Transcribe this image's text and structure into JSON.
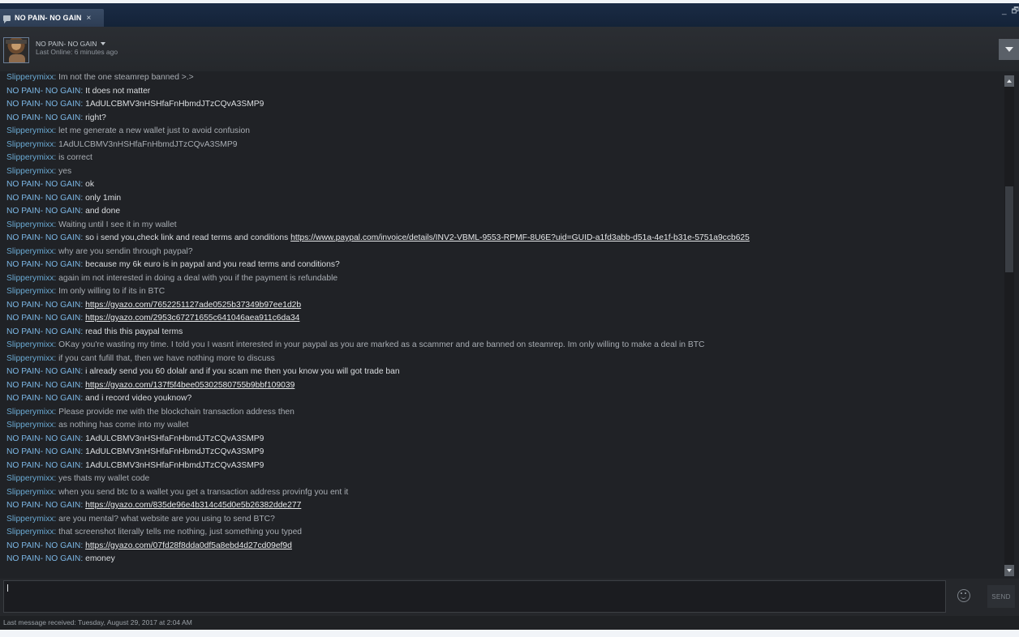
{
  "window": {
    "tab_title": "NO PAIN- NO GAIN",
    "tab_close": "×",
    "minimize": "_",
    "maximize": "🗗"
  },
  "header": {
    "friend_name": "NO PAIN- NO GAIN",
    "status": "Last Online: 6 minutes ago"
  },
  "messages": [
    {
      "sender": "Slipperymixx",
      "text": "Im not the one steamrep banned >.>",
      "link": false
    },
    {
      "sender": "NO PAIN- NO GAIN",
      "text": "It does not matter",
      "link": false
    },
    {
      "sender": "NO PAIN- NO GAIN",
      "text": "1AdULCBMV3nHSHfaFnHbmdJTzCQvA3SMP9",
      "link": false
    },
    {
      "sender": "NO PAIN- NO GAIN",
      "text": "right?",
      "link": false
    },
    {
      "sender": "Slipperymixx",
      "text": "let me generate a new wallet just to avoid confusion",
      "link": false
    },
    {
      "sender": "Slipperymixx",
      "text": "1AdULCBMV3nHSHfaFnHbmdJTzCQvA3SMP9",
      "link": false
    },
    {
      "sender": "Slipperymixx",
      "text": "is correct",
      "link": false
    },
    {
      "sender": "Slipperymixx",
      "text": "yes",
      "link": false
    },
    {
      "sender": "NO PAIN- NO GAIN",
      "text": "ok",
      "link": false
    },
    {
      "sender": "NO PAIN- NO GAIN",
      "text": "only 1min",
      "link": false
    },
    {
      "sender": "NO PAIN- NO GAIN",
      "text": "and done",
      "link": false
    },
    {
      "sender": "Slipperymixx",
      "text": "Waiting until I see it in my wallet",
      "link": false
    },
    {
      "sender": "NO PAIN- NO GAIN",
      "text": "so i send you,check link and read terms and conditions",
      "link": false,
      "url": "https://www.paypal.com/invoice/details/INV2-VBML-9553-RPMF-8U6E?uid=GUID-a1fd3abb-d51a-4e1f-b31e-5751a9ccb625"
    },
    {
      "sender": "Slipperymixx",
      "text": "why are you sendin through paypal?",
      "link": false
    },
    {
      "sender": "NO PAIN- NO GAIN",
      "text": "because my 6k euro is in paypal and you read terms and conditions?",
      "link": false
    },
    {
      "sender": "Slipperymixx",
      "text": "again im not interested in doing a deal with you if the payment is refundable",
      "link": false
    },
    {
      "sender": "Slipperymixx",
      "text": "Im only willing to if its in BTC",
      "link": false
    },
    {
      "sender": "NO PAIN- NO GAIN",
      "text": "https://gyazo.com/7652251127ade0525b37349b97ee1d2b",
      "link": true
    },
    {
      "sender": "NO PAIN- NO GAIN",
      "text": "https://gyazo.com/2953c67271655c641046aea911c6da34",
      "link": true
    },
    {
      "sender": "NO PAIN- NO GAIN",
      "text": "read this this paypal terms",
      "link": false
    },
    {
      "sender": "Slipperymixx",
      "text": "OKay you're wasting my time. I told you I wasnt interested in your paypal as you are marked as a scammer and are banned on steamrep. Im only willing to make a deal in BTC",
      "link": false
    },
    {
      "sender": "Slipperymixx",
      "text": "if you cant fufill that, then we have nothing more to discuss",
      "link": false
    },
    {
      "sender": "NO PAIN- NO GAIN",
      "text": "i already send you 60 dolalr and if you scam me then you know you will got trade ban",
      "link": false
    },
    {
      "sender": "NO PAIN- NO GAIN",
      "text": "https://gyazo.com/137f5f4bee05302580755b9bbf109039",
      "link": true
    },
    {
      "sender": "NO PAIN- NO GAIN",
      "text": "and i record video youknow?",
      "link": false
    },
    {
      "sender": "Slipperymixx",
      "text": "Please provide me with the blockchain transaction address then",
      "link": false
    },
    {
      "sender": "Slipperymixx",
      "text": "as nothing has come into my wallet",
      "link": false
    },
    {
      "sender": "NO PAIN- NO GAIN",
      "text": "1AdULCBMV3nHSHfaFnHbmdJTzCQvA3SMP9",
      "link": false
    },
    {
      "sender": "NO PAIN- NO GAIN",
      "text": "1AdULCBMV3nHSHfaFnHbmdJTzCQvA3SMP9",
      "link": false
    },
    {
      "sender": "NO PAIN- NO GAIN",
      "text": "1AdULCBMV3nHSHfaFnHbmdJTzCQvA3SMP9",
      "link": false
    },
    {
      "sender": "Slipperymixx",
      "text": "yes thats my wallet code",
      "link": false
    },
    {
      "sender": "Slipperymixx",
      "text": "when you send btc to a wallet you get a transaction address provinfg you ent it",
      "link": false
    },
    {
      "sender": "NO PAIN- NO GAIN",
      "text": "https://gyazo.com/835de96e4b314c45d0e5b26382dde277",
      "link": true
    },
    {
      "sender": "Slipperymixx",
      "text": "are you mental? what website are you using to send BTC?",
      "link": false
    },
    {
      "sender": "Slipperymixx",
      "text": "that screenshot literally tells me nothing, just something you typed",
      "link": false
    },
    {
      "sender": "NO PAIN- NO GAIN",
      "text": "https://gyazo.com/07fd28f8dda0df5a8ebd4d27cd09ef9d",
      "link": true
    },
    {
      "sender": "NO PAIN- NO GAIN",
      "text": "emoney",
      "link": false
    }
  ],
  "input": {
    "value": "",
    "send_label": "SEND"
  },
  "footer": {
    "last_message": "Last message received: Tuesday, August 29, 2017 at 2:04 AM"
  },
  "colors": {
    "sender_self": "#6aa9d2",
    "sender_friend": "#7bb6e4",
    "background": "#202226"
  }
}
